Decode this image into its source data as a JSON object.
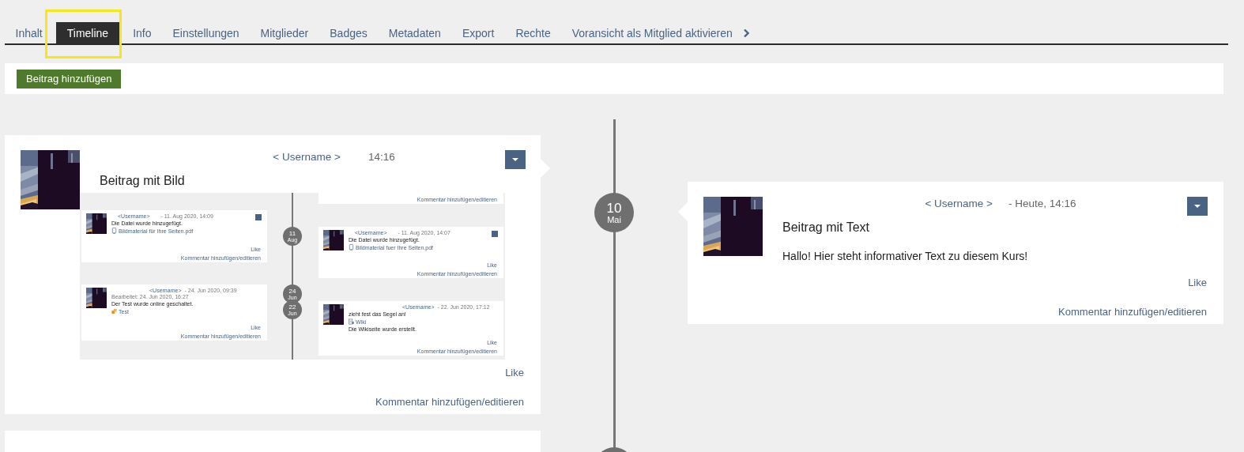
{
  "tabs": [
    {
      "label": "Inhalt",
      "selected": false
    },
    {
      "label": "Timeline",
      "selected": true
    },
    {
      "label": "Info",
      "selected": false
    },
    {
      "label": "Einstellungen",
      "selected": false
    },
    {
      "label": "Mitglieder",
      "selected": false
    },
    {
      "label": "Badges",
      "selected": false
    },
    {
      "label": "Metadaten",
      "selected": false
    },
    {
      "label": "Export",
      "selected": false
    },
    {
      "label": "Rechte",
      "selected": false
    },
    {
      "label": "Voransicht als Mitglied aktivieren",
      "selected": false
    }
  ],
  "toolbar": {
    "add_button": "Beitrag hinzufügen"
  },
  "timeline": {
    "date": {
      "day": "10",
      "month": "Mai"
    },
    "posts": [
      {
        "username": "< Username >",
        "time": "14:16",
        "title": "Beitrag mit Bild",
        "image": {
          "kind": "screenshot",
          "dates": [
            {
              "day": "11",
              "month": "Aug"
            },
            {
              "day": "24",
              "month": "Jun"
            },
            {
              "day": "22",
              "month": "Jun"
            }
          ],
          "posts": [
            {
              "comment": "Kommentar hinzufügen/editieren"
            },
            {
              "menu": true,
              "username": "<Username>",
              "time": "- 11. Aug 2020, 14:09",
              "text": "Die Datei wurde hinzugefügt.",
              "attachment": {
                "kind": "file",
                "label": "Bildmaterial für Ihre Seiten.pdf"
              },
              "like": "Like",
              "comment": "Kommentar hinzufügen/editieren"
            },
            {
              "menu": true,
              "username": "<Username>",
              "time": "- 11. Aug 2020, 14:07",
              "text": "Die Datei wurde hinzugefügt.",
              "attachment": {
                "kind": "file",
                "label": "Bildmaterial fuer Ihre Seiten.pdf"
              },
              "like": "Like",
              "comment": "Kommentar hinzufügen/editieren"
            },
            {
              "menu": false,
              "edited": "Bearbeitet: 24. Jun 2020, 16:27",
              "username": "<Username>",
              "time": "- 24. Jun 2020, 09:39",
              "text": "Der Test wurde online geschaltet.",
              "attachment": {
                "kind": "test",
                "label": "Test"
              },
              "like": "Like",
              "comment": "Kommentar hinzufügen/editieren"
            },
            {
              "menu": false,
              "username": "<Username>",
              "time": "- 22. Jun 2020, 17:12",
              "text": "zieht fest das Segel an!",
              "attachment": {
                "kind": "wiki",
                "label": "Wiki"
              },
              "note": "Die Wikiseite wurde erstellt.",
              "like": "Like",
              "comment": "Kommentar hinzufügen/editieren"
            }
          ]
        },
        "like": "Like",
        "comment": "Kommentar hinzufügen/editieren"
      }
    ],
    "right_posts": [
      {
        "username": "< Username >",
        "time": "- Heute, 14:16",
        "title": "Beitrag mit Text",
        "text": "Hallo! Hier steht informativer Text zu diesem Kurs!",
        "like": "Like",
        "comment": "Kommentar hinzufügen/editieren"
      }
    ]
  }
}
